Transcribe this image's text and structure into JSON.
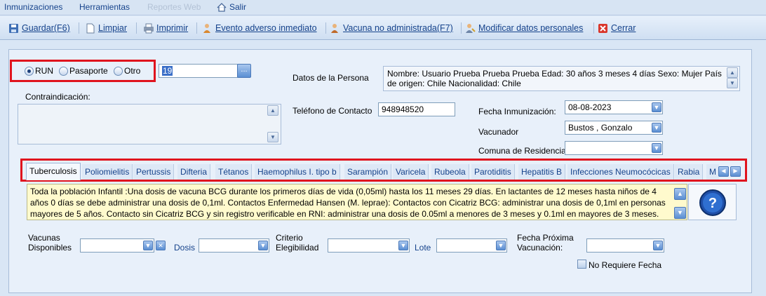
{
  "menu": {
    "items": [
      {
        "label": "Inmunizaciones",
        "enabled": true
      },
      {
        "label": "Herramientas",
        "enabled": true
      },
      {
        "label": "Reportes Web",
        "enabled": false
      },
      {
        "label": "Salir",
        "enabled": true
      }
    ]
  },
  "toolbar": {
    "guardar": "Guardar(F6)",
    "limpiar": "Limpiar",
    "imprimir": "Imprimir",
    "evento": "Evento adverso inmediato",
    "vacuna_no_adm": "Vacuna no administrada(F7)",
    "modificar": "Modificar datos personales",
    "cerrar": "Cerrar"
  },
  "identity": {
    "options": [
      "RUN",
      "Pasaporte",
      "Otro"
    ],
    "selected": "RUN",
    "id_value": "19",
    "lookup_button": "..."
  },
  "persona": {
    "label": "Datos de la Persona",
    "text": "Nombre: Usuario Prueba Prueba Prueba  Edad: 30 años 3 meses 4 días  Sexo: Mujer País de origen: Chile Nacionalidad: Chile"
  },
  "contraindicacion": {
    "label": "Contraindicación:",
    "value": ""
  },
  "telefono": {
    "label": "Teléfono de Contacto",
    "value": "948948520"
  },
  "fecha_inmunizacion": {
    "label": "Fecha Inmunización:",
    "value": "08-08-2023"
  },
  "vacunador": {
    "label": "Vacunador",
    "value": "Bustos , Gonzalo"
  },
  "comuna": {
    "label": "Comuna de Residencia",
    "value": ""
  },
  "tabs": [
    "Tuberculosis",
    "Poliomielitis",
    "Pertussis",
    "Difteria",
    "Tétanos",
    "Haemophilus I. tipo b",
    "Sarampión",
    "Varicela",
    "Rubeola",
    "Parotiditis",
    "Hepatitis B",
    "Infecciones Neumocócicas",
    "Rabia",
    "M"
  ],
  "active_tab": "Tuberculosis",
  "info_text": "Toda la población Infantil :Una dosis de vacuna BCG durante los primeros días de vida (0,05ml) hasta los 11 meses 29 días. En lactantes de 12 meses hasta niños de 4 años 0 días se debe administrar una dosis de 0,1ml. Contactos Enfermedad Hansen (M. leprae):  Contactos con Cicatriz BCG: administrar una dosis de 0,1ml en personas mayores de 5 años.  Contacto sin Cicatriz BCG y sin registro verificable en RNI: administrar una dosis de 0.05ml a menores de 3 meses y 0.1ml en mayores de 3 meses.",
  "bottom": {
    "vacunas_label": "Vacunas\nDisponibles",
    "dosis_label": "Dosis",
    "criterio_label": "Criterio\nElegibilidad",
    "lote_label": "Lote",
    "proxima_label": "Fecha Próxima\nVacunación:",
    "no_requiere_label": "No Requiere Fecha"
  },
  "colors": {
    "highlight": "#e0141e",
    "info_bg": "#fffacd",
    "panel_bg": "#e8f0fa",
    "accent": "#15428b"
  }
}
